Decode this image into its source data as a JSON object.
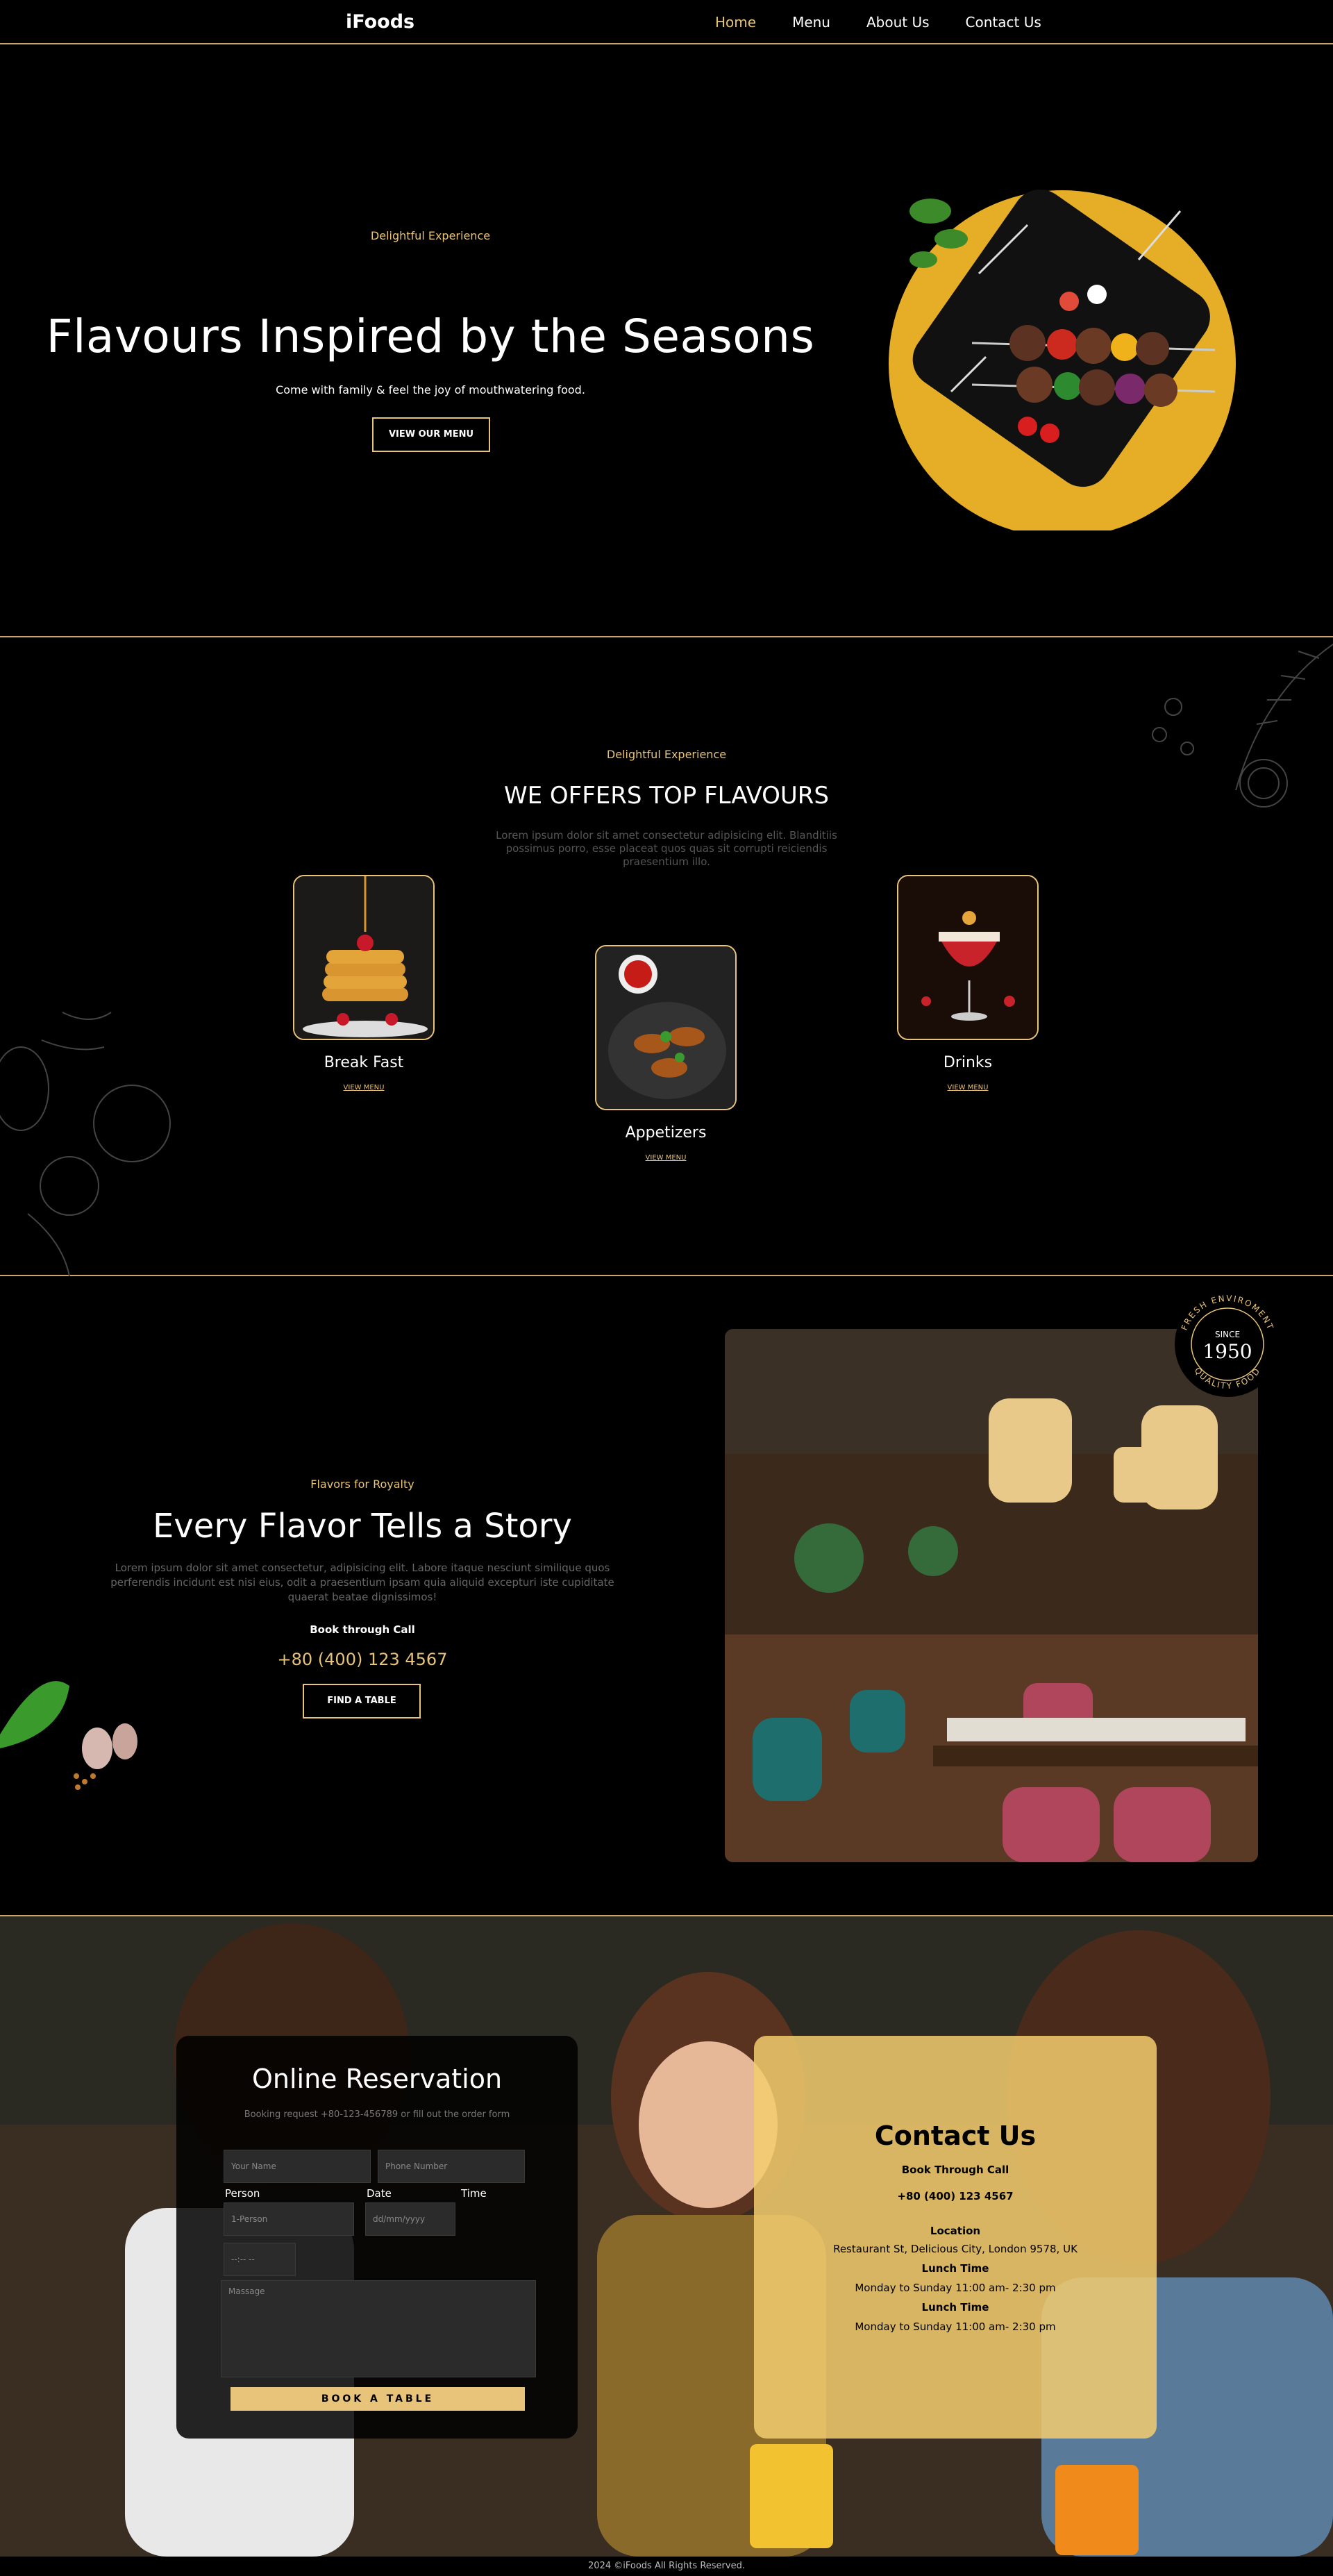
{
  "nav": {
    "brand": "iFoods",
    "links": [
      "Home",
      "Menu",
      "About Us",
      "Contact Us"
    ]
  },
  "hero": {
    "eyebrow": "Delightful Experience",
    "title": "Flavours Inspired by the Seasons",
    "subtitle": "Come with family & feel the joy of mouthwatering food.",
    "cta": "VIEW OUR MENU"
  },
  "offers": {
    "eyebrow": "Delightful Experience",
    "title": "WE OFFERS TOP FLAVOURS",
    "description": "Lorem ipsum dolor sit amet consectetur adipisicing elit. Blanditiis possimus porro, esse placeat quos quas sit corrupti reiciendis praesentium illo.",
    "cards": [
      {
        "title": "Break Fast",
        "link": "VIEW MENU"
      },
      {
        "title": "Appetizers",
        "link": "VIEW MENU"
      },
      {
        "title": "Drinks",
        "link": "VIEW MENU"
      }
    ]
  },
  "story": {
    "eyebrow": "Flavors for Royalty",
    "title": "Every Flavor Tells a Story",
    "description": "Lorem ipsum dolor sit amet consectetur, adipisicing elit. Labore itaque nesciunt similique quos perferendis incidunt est nisi eius, odit a praesentium ipsam quia aliquid excepturi iste cupiditate quaerat beatae dignissimos!",
    "book_label": "Book through Call",
    "phone": "+80 (400) 123 4567",
    "cta": "FIND A TABLE",
    "seal": {
      "top": "FRESH ENVIROMENT",
      "bottom": "QUALITY FOOD",
      "since": "SINCE",
      "year": "1950"
    }
  },
  "reservation": {
    "title": "Online Reservation",
    "hint": "Booking request +80-123-456789 or fill out the order form",
    "name_placeholder": "Your Name",
    "phone_placeholder": "Phone Number",
    "person_label": "Person",
    "date_label": "Date",
    "time_label": "Time",
    "person_value": "1-Person",
    "date_value": "dd/mm/yyyy",
    "time_value": "--:-- --",
    "message_placeholder": "Massage",
    "button": "BOOK A TABLE"
  },
  "contact": {
    "title": "Contact Us",
    "book_label": "Book Through Call",
    "phone": "+80 (400) 123 4567",
    "location_label": "Location",
    "location": "Restaurant St, Delicious City, London 9578, UK",
    "lunch_label_1": "Lunch Time",
    "lunch_hours_1": "Monday to Sunday 11:00 am- 2:30 pm",
    "lunch_label_2": "Lunch Time",
    "lunch_hours_2": "Monday to Sunday 11:00 am- 2:30 pm"
  },
  "footer": {
    "text": "2024 ©iFoods All Rights Reserved."
  },
  "colors": {
    "accent": "#e8c37a",
    "background": "#000000",
    "contact_card": "#f3cc6e"
  }
}
